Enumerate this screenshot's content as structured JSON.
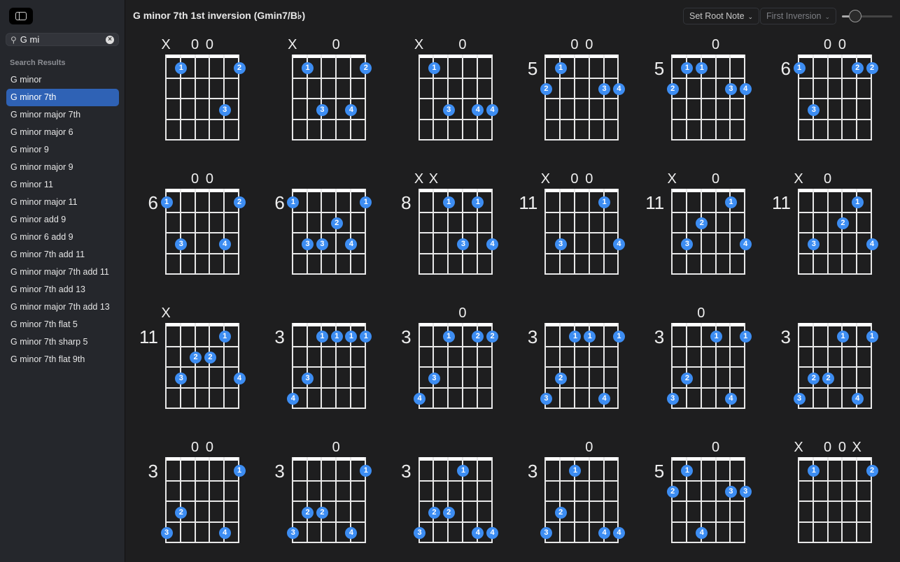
{
  "sidebar": {
    "search_value": "G mi",
    "section_label": "Search Results",
    "selected_index": 1,
    "items": [
      "G minor",
      "G minor 7th",
      "G minor major 7th",
      "G minor major 6",
      "G minor 9",
      "G minor major 9",
      "G minor 11",
      "G minor major 11",
      "G minor add 9",
      "G minor 6 add 9",
      "G minor 7th add 11",
      "G minor major 7th add 11",
      "G minor 7th add 13",
      "G minor major 7th add 13",
      "G minor 7th flat 5",
      "G minor 7th sharp 5",
      "G minor 7th flat 9th"
    ]
  },
  "header": {
    "title": "G minor 7th 1st inversion (Gmin7/B♭)",
    "root_note_label": "Set Root Note",
    "inversion_label": "First Inversion",
    "zoom_slider_value": 0.25
  },
  "colors": {
    "accent": "#2f62b5",
    "dot": "#3d8df2"
  },
  "chords": [
    {
      "position": "",
      "markers": [
        "X",
        "",
        "0",
        "0",
        "",
        ""
      ],
      "dots": [
        [
          1,
          1,
          1
        ],
        [
          5,
          1,
          2
        ],
        [
          4,
          3,
          3
        ]
      ]
    },
    {
      "position": "",
      "markers": [
        "X",
        "",
        "",
        "0",
        "",
        ""
      ],
      "dots": [
        [
          1,
          1,
          1
        ],
        [
          5,
          1,
          2
        ],
        [
          2,
          3,
          3
        ],
        [
          4,
          3,
          4
        ]
      ]
    },
    {
      "position": "",
      "markers": [
        "X",
        "",
        "",
        "0",
        "",
        ""
      ],
      "dots": [
        [
          1,
          1,
          1
        ],
        [
          2,
          3,
          3
        ],
        [
          4,
          3,
          4
        ],
        [
          5,
          3,
          4
        ]
      ]
    },
    {
      "position": "5",
      "markers": [
        "",
        "",
        "0",
        "0",
        "",
        ""
      ],
      "dots": [
        [
          1,
          1,
          1
        ],
        [
          0,
          2,
          2
        ],
        [
          4,
          2,
          3
        ],
        [
          5,
          2,
          4
        ]
      ]
    },
    {
      "position": "5",
      "markers": [
        "",
        "",
        "",
        "0",
        "",
        ""
      ],
      "dots": [
        [
          1,
          1,
          1
        ],
        [
          2,
          1,
          1
        ],
        [
          0,
          2,
          2
        ],
        [
          4,
          2,
          3
        ],
        [
          5,
          2,
          4
        ]
      ]
    },
    {
      "position": "6",
      "markers": [
        "",
        "",
        "0",
        "0",
        "",
        ""
      ],
      "dots": [
        [
          0,
          1,
          1
        ],
        [
          4,
          1,
          2
        ],
        [
          5,
          1,
          2
        ],
        [
          1,
          3,
          3
        ]
      ]
    },
    {
      "position": "6",
      "markers": [
        "",
        "",
        "0",
        "0",
        "",
        ""
      ],
      "dots": [
        [
          0,
          1,
          1
        ],
        [
          5,
          1,
          2
        ],
        [
          1,
          3,
          3
        ],
        [
          4,
          3,
          4
        ]
      ]
    },
    {
      "position": "6",
      "markers": [
        "",
        "",
        "",
        "",
        "",
        ""
      ],
      "dots": [
        [
          0,
          1,
          1
        ],
        [
          5,
          1,
          1
        ],
        [
          3,
          2,
          2
        ],
        [
          1,
          3,
          3
        ],
        [
          2,
          3,
          3
        ],
        [
          4,
          3,
          4
        ]
      ]
    },
    {
      "position": "8",
      "markers": [
        "X",
        "X",
        "",
        "",
        "",
        ""
      ],
      "dots": [
        [
          2,
          1,
          1
        ],
        [
          4,
          1,
          1
        ],
        [
          3,
          3,
          3
        ],
        [
          5,
          3,
          4
        ]
      ]
    },
    {
      "position": "11",
      "markers": [
        "X",
        "",
        "0",
        "0",
        "",
        ""
      ],
      "dots": [
        [
          4,
          1,
          1
        ],
        [
          1,
          3,
          3
        ],
        [
          5,
          3,
          4
        ]
      ]
    },
    {
      "position": "11",
      "markers": [
        "X",
        "",
        "",
        "0",
        "",
        ""
      ],
      "dots": [
        [
          4,
          1,
          1
        ],
        [
          2,
          2,
          2
        ],
        [
          1,
          3,
          3
        ],
        [
          5,
          3,
          4
        ]
      ]
    },
    {
      "position": "11",
      "markers": [
        "X",
        "",
        "0",
        "",
        "",
        ""
      ],
      "dots": [
        [
          4,
          1,
          1
        ],
        [
          3,
          2,
          2
        ],
        [
          1,
          3,
          3
        ],
        [
          5,
          3,
          4
        ]
      ]
    },
    {
      "position": "11",
      "markers": [
        "X",
        "",
        "",
        "",
        "",
        ""
      ],
      "dots": [
        [
          4,
          1,
          1
        ],
        [
          2,
          2,
          2
        ],
        [
          3,
          2,
          2
        ],
        [
          1,
          3,
          3
        ],
        [
          5,
          3,
          4
        ]
      ]
    },
    {
      "position": "3",
      "markers": [
        "",
        "",
        "",
        "",
        "",
        ""
      ],
      "dots": [
        [
          2,
          1,
          1
        ],
        [
          3,
          1,
          1
        ],
        [
          4,
          1,
          1
        ],
        [
          5,
          1,
          1
        ],
        [
          1,
          3,
          3
        ],
        [
          0,
          4,
          4
        ]
      ]
    },
    {
      "position": "3",
      "markers": [
        "",
        "",
        "",
        "0",
        "",
        ""
      ],
      "dots": [
        [
          2,
          1,
          1
        ],
        [
          4,
          1,
          2
        ],
        [
          5,
          1,
          2
        ],
        [
          1,
          3,
          3
        ],
        [
          0,
          4,
          4
        ]
      ]
    },
    {
      "position": "3",
      "markers": [
        "",
        "",
        "",
        "",
        "",
        ""
      ],
      "dots": [
        [
          2,
          1,
          1
        ],
        [
          3,
          1,
          1
        ],
        [
          5,
          1,
          1
        ],
        [
          1,
          3,
          2
        ],
        [
          0,
          4,
          3
        ],
        [
          4,
          4,
          4
        ]
      ]
    },
    {
      "position": "3",
      "markers": [
        "",
        "",
        "0",
        "",
        "",
        ""
      ],
      "dots": [
        [
          3,
          1,
          1
        ],
        [
          5,
          1,
          1
        ],
        [
          1,
          3,
          2
        ],
        [
          0,
          4,
          3
        ],
        [
          4,
          4,
          4
        ]
      ]
    },
    {
      "position": "3",
      "markers": [
        "",
        "",
        "",
        "",
        "",
        ""
      ],
      "dots": [
        [
          3,
          1,
          1
        ],
        [
          5,
          1,
          1
        ],
        [
          1,
          3,
          2
        ],
        [
          2,
          3,
          2
        ],
        [
          0,
          4,
          3
        ],
        [
          4,
          4,
          4
        ]
      ]
    },
    {
      "position": "3",
      "markers": [
        "",
        "",
        "0",
        "0",
        "",
        ""
      ],
      "dots": [
        [
          5,
          1,
          1
        ],
        [
          1,
          3,
          2
        ],
        [
          0,
          4,
          3
        ],
        [
          4,
          4,
          4
        ]
      ]
    },
    {
      "position": "3",
      "markers": [
        "",
        "",
        "",
        "0",
        "",
        ""
      ],
      "dots": [
        [
          5,
          1,
          1
        ],
        [
          1,
          3,
          2
        ],
        [
          2,
          3,
          2
        ],
        [
          0,
          4,
          3
        ],
        [
          4,
          4,
          4
        ]
      ]
    },
    {
      "position": "3",
      "markers": [
        "",
        "",
        "",
        "",
        "",
        ""
      ],
      "dots": [
        [
          3,
          1,
          1
        ],
        [
          1,
          3,
          2
        ],
        [
          2,
          3,
          2
        ],
        [
          0,
          4,
          3
        ],
        [
          4,
          4,
          4
        ],
        [
          5,
          4,
          4
        ]
      ]
    },
    {
      "position": "3",
      "markers": [
        "",
        "",
        "",
        "0",
        "",
        ""
      ],
      "dots": [
        [
          2,
          1,
          1
        ],
        [
          1,
          3,
          2
        ],
        [
          0,
          4,
          3
        ],
        [
          4,
          4,
          4
        ],
        [
          5,
          4,
          4
        ]
      ]
    },
    {
      "position": "5",
      "markers": [
        "",
        "",
        "",
        "0",
        "",
        ""
      ],
      "dots": [
        [
          1,
          1,
          1
        ],
        [
          0,
          2,
          2
        ],
        [
          4,
          2,
          3
        ],
        [
          5,
          2,
          3
        ],
        [
          2,
          4,
          4
        ]
      ]
    },
    {
      "position": "",
      "markers": [
        "X",
        "",
        "0",
        "0",
        "X",
        ""
      ],
      "dots": [
        [
          1,
          1,
          1
        ],
        [
          5,
          1,
          2
        ]
      ]
    }
  ]
}
